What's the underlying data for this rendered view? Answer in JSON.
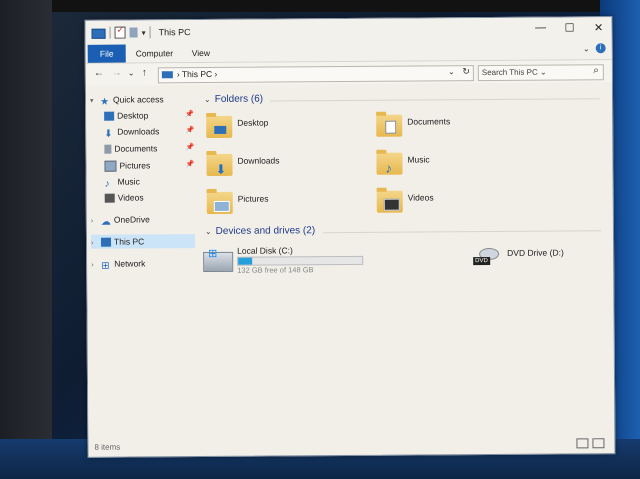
{
  "window": {
    "title": "This PC",
    "minimize": "—",
    "maximize": "☐",
    "close": "✕"
  },
  "ribbon": {
    "tabs": [
      "File",
      "Computer",
      "View"
    ],
    "expand": "⌄",
    "help": "i"
  },
  "nav": {
    "back": "←",
    "forward": "→",
    "history": "⌄",
    "up": "↑",
    "address": "This PC",
    "address_caret": "›",
    "search_placeholder": "Search This PC",
    "search_caret": "⌄"
  },
  "sidebar": {
    "items": [
      {
        "label": "Quick access",
        "icon": "star-icon"
      },
      {
        "label": "Desktop",
        "icon": "desktop-icon",
        "pinned": true
      },
      {
        "label": "Downloads",
        "icon": "downloads-icon",
        "pinned": true
      },
      {
        "label": "Documents",
        "icon": "documents-icon",
        "pinned": true
      },
      {
        "label": "Pictures",
        "icon": "pictures-icon",
        "pinned": true
      },
      {
        "label": "Music",
        "icon": "music-icon"
      },
      {
        "label": "Videos",
        "icon": "videos-icon"
      },
      {
        "label": "OneDrive",
        "icon": "onedrive-icon"
      },
      {
        "label": "This PC",
        "icon": "this-pc-icon",
        "selected": true
      },
      {
        "label": "Network",
        "icon": "network-icon"
      }
    ]
  },
  "content": {
    "folders_header": "Folders (6)",
    "folders": [
      {
        "name": "Desktop",
        "icon": "desktop-folder-icon"
      },
      {
        "name": "Documents",
        "icon": "documents-folder-icon"
      },
      {
        "name": "Downloads",
        "icon": "downloads-folder-icon"
      },
      {
        "name": "Music",
        "icon": "music-folder-icon"
      },
      {
        "name": "Pictures",
        "icon": "pictures-folder-icon"
      },
      {
        "name": "Videos",
        "icon": "videos-folder-icon"
      }
    ],
    "drives_header": "Devices and drives (2)",
    "drives": [
      {
        "name": "Local Disk (C:)",
        "free_text": "132 GB free of 148 GB",
        "used_fraction": 0.11,
        "icon": "local-disk-icon"
      },
      {
        "name": "DVD Drive (D:)",
        "icon": "dvd-drive-icon",
        "badge": "DVD"
      }
    ]
  },
  "status": {
    "items_count": "8 items"
  },
  "colors": {
    "accent": "#1a5fb4",
    "selection": "#cce4f7",
    "header_blue": "#1e3a8a",
    "drive_bar": "#26a0da"
  }
}
